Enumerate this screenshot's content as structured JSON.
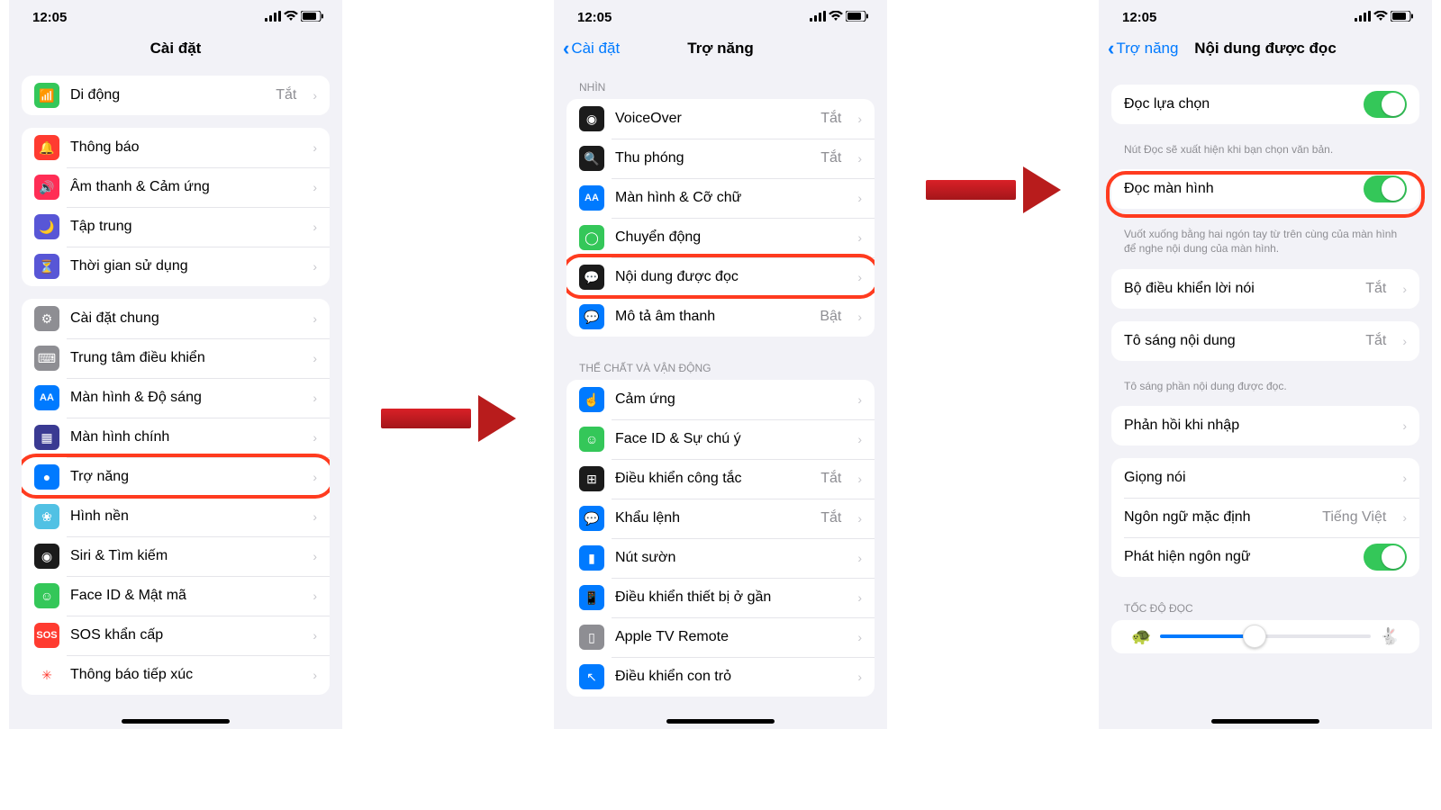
{
  "status": {
    "time": "12:05"
  },
  "screen1": {
    "title": "Cài đặt",
    "rows_top": [
      {
        "label": "Di động",
        "value": "Tắt",
        "icon": "cellular-icon",
        "bg": "#34c759"
      }
    ],
    "rows_notif": [
      {
        "label": "Thông báo",
        "icon": "bell-icon",
        "bg": "#ff3b30"
      },
      {
        "label": "Âm thanh & Cảm ứng",
        "icon": "sound-icon",
        "bg": "#ff2d55"
      },
      {
        "label": "Tập trung",
        "icon": "moon-icon",
        "bg": "#5856d6"
      },
      {
        "label": "Thời gian sử dụng",
        "icon": "hourglass-icon",
        "bg": "#5856d6"
      }
    ],
    "rows_general": [
      {
        "label": "Cài đặt chung",
        "icon": "gear-icon",
        "bg": "#8e8e93"
      },
      {
        "label": "Trung tâm điều khiển",
        "icon": "switches-icon",
        "bg": "#8e8e93"
      },
      {
        "label": "Màn hình & Độ sáng",
        "icon": "text-size-icon",
        "bg": "#007aff",
        "iconText": "AA"
      },
      {
        "label": "Màn hình chính",
        "icon": "grid-icon",
        "bg": "#3a3a92"
      },
      {
        "label": "Trợ năng",
        "icon": "accessibility-icon",
        "bg": "#007aff",
        "highlight": true
      },
      {
        "label": "Hình nền",
        "icon": "wallpaper-icon",
        "bg": "#51c1e4"
      },
      {
        "label": "Siri & Tìm kiếm",
        "icon": "siri-icon",
        "bg": "#1b1b1b"
      },
      {
        "label": "Face ID & Mật mã",
        "icon": "faceid-icon",
        "bg": "#34c759"
      },
      {
        "label": "SOS khẩn cấp",
        "icon": "sos-icon",
        "bg": "#ff3b30",
        "iconText": "SOS"
      },
      {
        "label": "Thông báo tiếp xúc",
        "icon": "exposure-icon",
        "bg": "#fff",
        "fg": "#ff3b30"
      }
    ]
  },
  "screen2": {
    "back": "Cài đặt",
    "title": "Trợ năng",
    "section_vision": "NHÌN",
    "rows_vision": [
      {
        "label": "VoiceOver",
        "value": "Tắt",
        "icon": "voiceover-icon",
        "bg": "#1b1b1b"
      },
      {
        "label": "Thu phóng",
        "value": "Tắt",
        "icon": "zoom-icon",
        "bg": "#1b1b1b"
      },
      {
        "label": "Màn hình & Cỡ chữ",
        "icon": "text-size-icon",
        "bg": "#007aff",
        "iconText": "AA"
      },
      {
        "label": "Chuyển động",
        "icon": "motion-icon",
        "bg": "#34c759"
      },
      {
        "label": "Nội dung được đọc",
        "icon": "speech-bubble-icon",
        "bg": "#1b1b1b",
        "highlight": true
      },
      {
        "label": "Mô tả âm thanh",
        "value": "Bật",
        "icon": "audio-desc-icon",
        "bg": "#007aff"
      }
    ],
    "section_physical": "THỂ CHẤT VÀ VẬN ĐỘNG",
    "rows_physical": [
      {
        "label": "Cảm ứng",
        "icon": "touch-icon",
        "bg": "#007aff"
      },
      {
        "label": "Face ID & Sự chú ý",
        "icon": "faceid-icon",
        "bg": "#34c759"
      },
      {
        "label": "Điều khiển công tắc",
        "value": "Tắt",
        "icon": "switch-control-icon",
        "bg": "#1b1b1b"
      },
      {
        "label": "Khẩu lệnh",
        "value": "Tắt",
        "icon": "voice-control-icon",
        "bg": "#007aff"
      },
      {
        "label": "Nút sườn",
        "icon": "side-button-icon",
        "bg": "#007aff"
      },
      {
        "label": "Điều khiển thiết bị ở gần",
        "icon": "nearby-icon",
        "bg": "#007aff"
      },
      {
        "label": "Apple TV Remote",
        "icon": "remote-icon",
        "bg": "#8e8e93"
      },
      {
        "label": "Điều khiển con trỏ",
        "icon": "pointer-icon",
        "bg": "#007aff"
      }
    ]
  },
  "screen3": {
    "back": "Trợ năng",
    "title": "Nội dung được đọc",
    "speak_selection": {
      "label": "Đọc lựa chọn",
      "on": true
    },
    "speak_selection_footer": "Nút Đọc sẽ xuất hiện khi bạn chọn văn bản.",
    "speak_screen": {
      "label": "Đọc màn hình",
      "on": true,
      "highlight": true
    },
    "speak_screen_footer": "Vuốt xuống bằng hai ngón tay từ trên cùng của màn hình để nghe nội dung của màn hình.",
    "speech_controller": {
      "label": "Bộ điều khiển lời nói",
      "value": "Tắt"
    },
    "highlight_content": {
      "label": "Tô sáng nội dung",
      "value": "Tắt"
    },
    "highlight_content_footer": "Tô sáng phần nội dung được đọc.",
    "typing_feedback": {
      "label": "Phản hồi khi nhập"
    },
    "voices": {
      "label": "Giọng nói"
    },
    "default_lang": {
      "label": "Ngôn ngữ mặc định",
      "value": "Tiếng Việt"
    },
    "detect_lang": {
      "label": "Phát hiện ngôn ngữ",
      "on": true
    },
    "speed_header": "TỐC ĐỘ ĐỌC"
  }
}
